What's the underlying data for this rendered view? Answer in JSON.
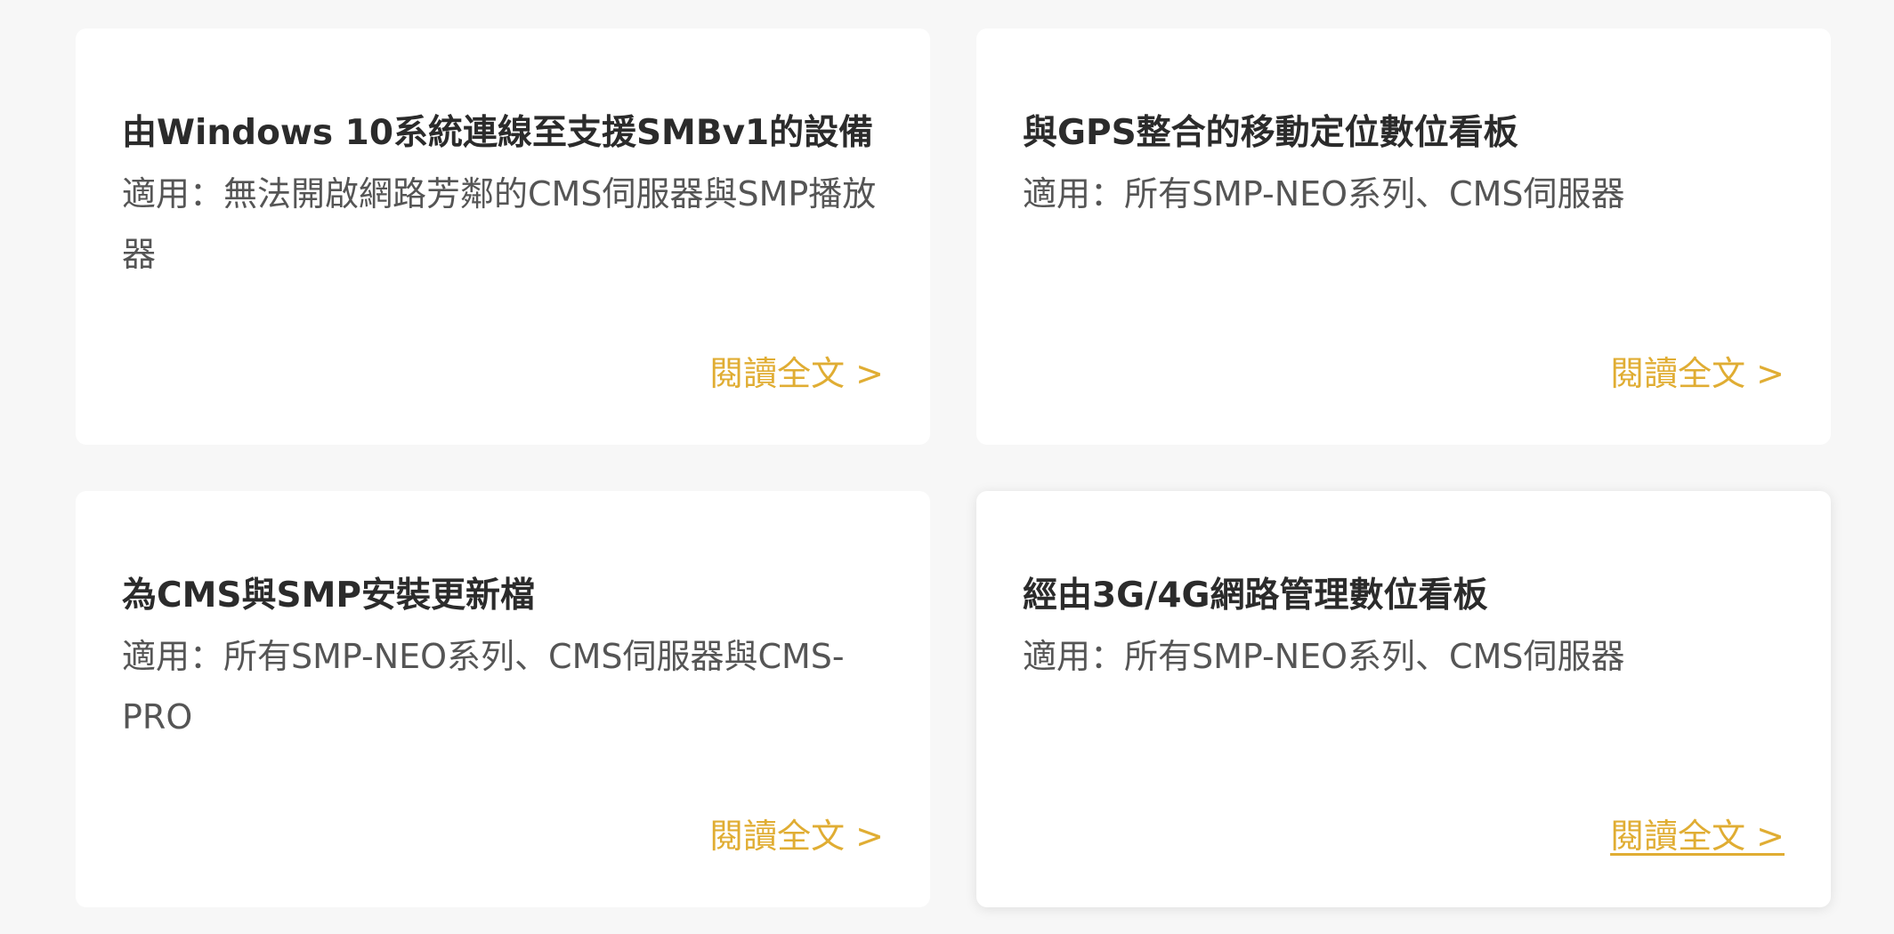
{
  "cards": [
    {
      "title": "由Windows 10系統連線至支援SMBv1的設備",
      "description": "適用：無法開啟網路芳鄰的CMS伺服器與SMP播放器",
      "link_label": "閱讀全文 >"
    },
    {
      "title": "與GPS整合的移動定位數位看板",
      "description": "適用：所有SMP-NEO系列、CMS伺服器",
      "link_label": "閱讀全文 >"
    },
    {
      "title": "為CMS與SMP安裝更新檔",
      "description": "適用：所有SMP-NEO系列、CMS伺服器與CMS-PRO",
      "link_label": "閱讀全文 >"
    },
    {
      "title": "經由3G/4G網路管理數位看板",
      "description": "適用：所有SMP-NEO系列、CMS伺服器",
      "link_label": "閱讀全文 >"
    }
  ],
  "colors": {
    "background": "#f7f7f7",
    "card": "#ffffff",
    "title": "#2b2b2b",
    "description": "#555555",
    "link": "#e0ad33"
  }
}
